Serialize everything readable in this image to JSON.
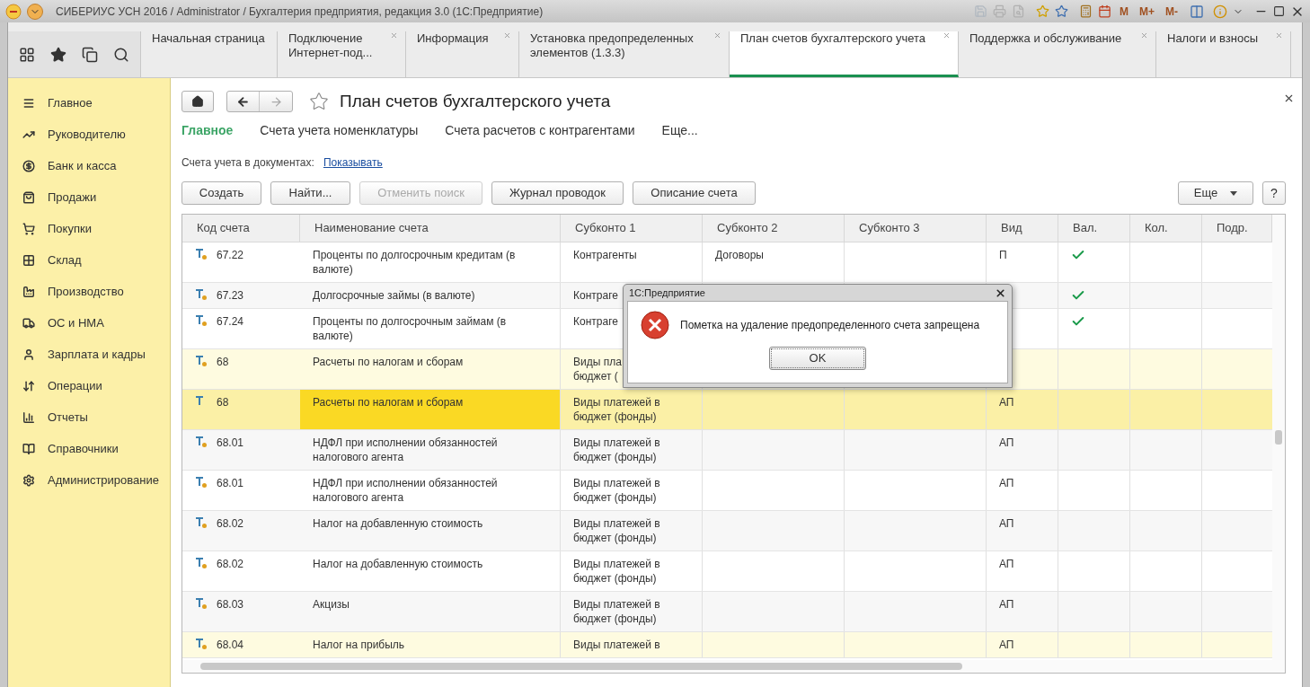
{
  "window": {
    "title": "СИБЕРИУС УСН 2016 / Administrator / Бухгалтерия предприятия, редакция 3.0  (1С:Предприятие)",
    "memory_buttons": [
      "M",
      "M+",
      "M-"
    ]
  },
  "tabs": [
    {
      "label": "Начальная страница",
      "selected": false,
      "closable": false
    },
    {
      "label": "Подключение Интернет-под...",
      "selected": false,
      "closable": true
    },
    {
      "label": "Информация",
      "selected": false,
      "closable": true
    },
    {
      "label": "Установка предопределенных элементов (1.3.3)",
      "selected": false,
      "closable": true
    },
    {
      "label": "План счетов бухгалтерского учета",
      "selected": true,
      "closable": true
    },
    {
      "label": "Поддержка и обслуживание",
      "selected": false,
      "closable": true
    },
    {
      "label": "Налоги и взносы",
      "selected": false,
      "closable": true
    }
  ],
  "sidebar": {
    "items": [
      {
        "label": "Главное",
        "kind": "menu"
      },
      {
        "label": "Руководителю",
        "kind": "trend"
      },
      {
        "label": "Банк и касса",
        "kind": "bank"
      },
      {
        "label": "Продажи",
        "kind": "sales"
      },
      {
        "label": "Покупки",
        "kind": "purchases"
      },
      {
        "label": "Склад",
        "kind": "warehouse"
      },
      {
        "label": "Производство",
        "kind": "production"
      },
      {
        "label": "ОС и НМА",
        "kind": "assets"
      },
      {
        "label": "Зарплата и кадры",
        "kind": "staff"
      },
      {
        "label": "Операции",
        "kind": "operations"
      },
      {
        "label": "Отчеты",
        "kind": "reports"
      },
      {
        "label": "Справочники",
        "kind": "catalogs"
      },
      {
        "label": "Администрирование",
        "kind": "admin"
      }
    ]
  },
  "form": {
    "title": "План счетов бухгалтерского учета",
    "nav": [
      {
        "label": "Главное",
        "selected": true
      },
      {
        "label": "Счета учета номенклатуры",
        "selected": false
      },
      {
        "label": "Счета расчетов с контрагентами",
        "selected": false
      },
      {
        "label": "Еще...",
        "selected": false
      }
    ],
    "docs_label": "Счета учета в документах:",
    "docs_link": "Показывать",
    "buttons": [
      {
        "label": "Создать",
        "disabled": false
      },
      {
        "label": "Найти...",
        "disabled": false
      },
      {
        "label": "Отменить поиск",
        "disabled": true
      },
      {
        "label": "Журнал проводок",
        "disabled": false
      },
      {
        "label": "Описание счета",
        "disabled": false
      }
    ],
    "more_button": "Еще",
    "help_button": "?"
  },
  "table": {
    "columns": [
      "Код счета",
      "Наименование счета",
      "Субконто 1",
      "Субконто 2",
      "Субконто 3",
      "Вид",
      "Вал.",
      "Кол.",
      "Подр."
    ],
    "rows": [
      {
        "dot": true,
        "code": "67.22",
        "name": "Проценты по долгосрочным кредитам (в валюте)",
        "sub1": [
          "Контрагенты"
        ],
        "sub2": "Договоры",
        "vid": "П",
        "currency": true,
        "highlight": false,
        "selected": false
      },
      {
        "dot": true,
        "code": "67.23",
        "name": "Долгосрочные займы (в валюте)",
        "sub1": [
          "Контраге"
        ],
        "currency": true,
        "highlight": false,
        "selected": false
      },
      {
        "dot": true,
        "code": "67.24",
        "name": "Проценты по долгосрочным займам (в валюте)",
        "sub1": [
          "Контраге"
        ],
        "currency": true,
        "highlight": false,
        "selected": false
      },
      {
        "dot": true,
        "code": "68",
        "name": "Расчеты по налогам и сборам",
        "sub1": [
          "Виды пла",
          "бюджет ("
        ],
        "currency": false,
        "highlight": true,
        "selected": false
      },
      {
        "dot": false,
        "code": "68",
        "name": "Расчеты по налогам и сборам",
        "sub1": [
          "Виды платежей в",
          "бюджет (фонды)"
        ],
        "vid": "АП",
        "currency": false,
        "highlight": false,
        "selected": true
      },
      {
        "dot": true,
        "code": "68.01",
        "name": "НДФЛ при исполнении обязанностей налогового агента",
        "sub1": [
          "Виды платежей в",
          "бюджет (фонды)"
        ],
        "vid": "АП",
        "currency": false,
        "highlight": false,
        "selected": false
      },
      {
        "dot": true,
        "code": "68.01",
        "name": "НДФЛ при исполнении обязанностей налогового агента",
        "sub1": [
          "Виды платежей в",
          "бюджет (фонды)"
        ],
        "vid": "АП",
        "currency": false,
        "highlight": false,
        "selected": false
      },
      {
        "dot": true,
        "code": "68.02",
        "name": "Налог на добавленную стоимость",
        "sub1": [
          "Виды платежей в",
          "бюджет (фонды)"
        ],
        "vid": "АП",
        "currency": false,
        "highlight": false,
        "selected": false
      },
      {
        "dot": true,
        "code": "68.02",
        "name": "Налог на добавленную стоимость",
        "sub1": [
          "Виды платежей в",
          "бюджет (фонды)"
        ],
        "vid": "АП",
        "currency": false,
        "highlight": false,
        "selected": false
      },
      {
        "dot": true,
        "code": "68.03",
        "name": "Акцизы",
        "sub1": [
          "Виды платежей в",
          "бюджет (фонды)"
        ],
        "vid": "АП",
        "currency": false,
        "highlight": false,
        "selected": false
      },
      {
        "dot": true,
        "code": "68.04",
        "name": "Налог на прибыль",
        "sub1": [
          "Виды платежей в"
        ],
        "vid": "АП",
        "currency": false,
        "highlight": true,
        "selected": false
      }
    ]
  },
  "dialog": {
    "title": "1С:Предприятие",
    "message": "Пометка на удаление предопределенного счета запрещена",
    "button": "OK"
  }
}
